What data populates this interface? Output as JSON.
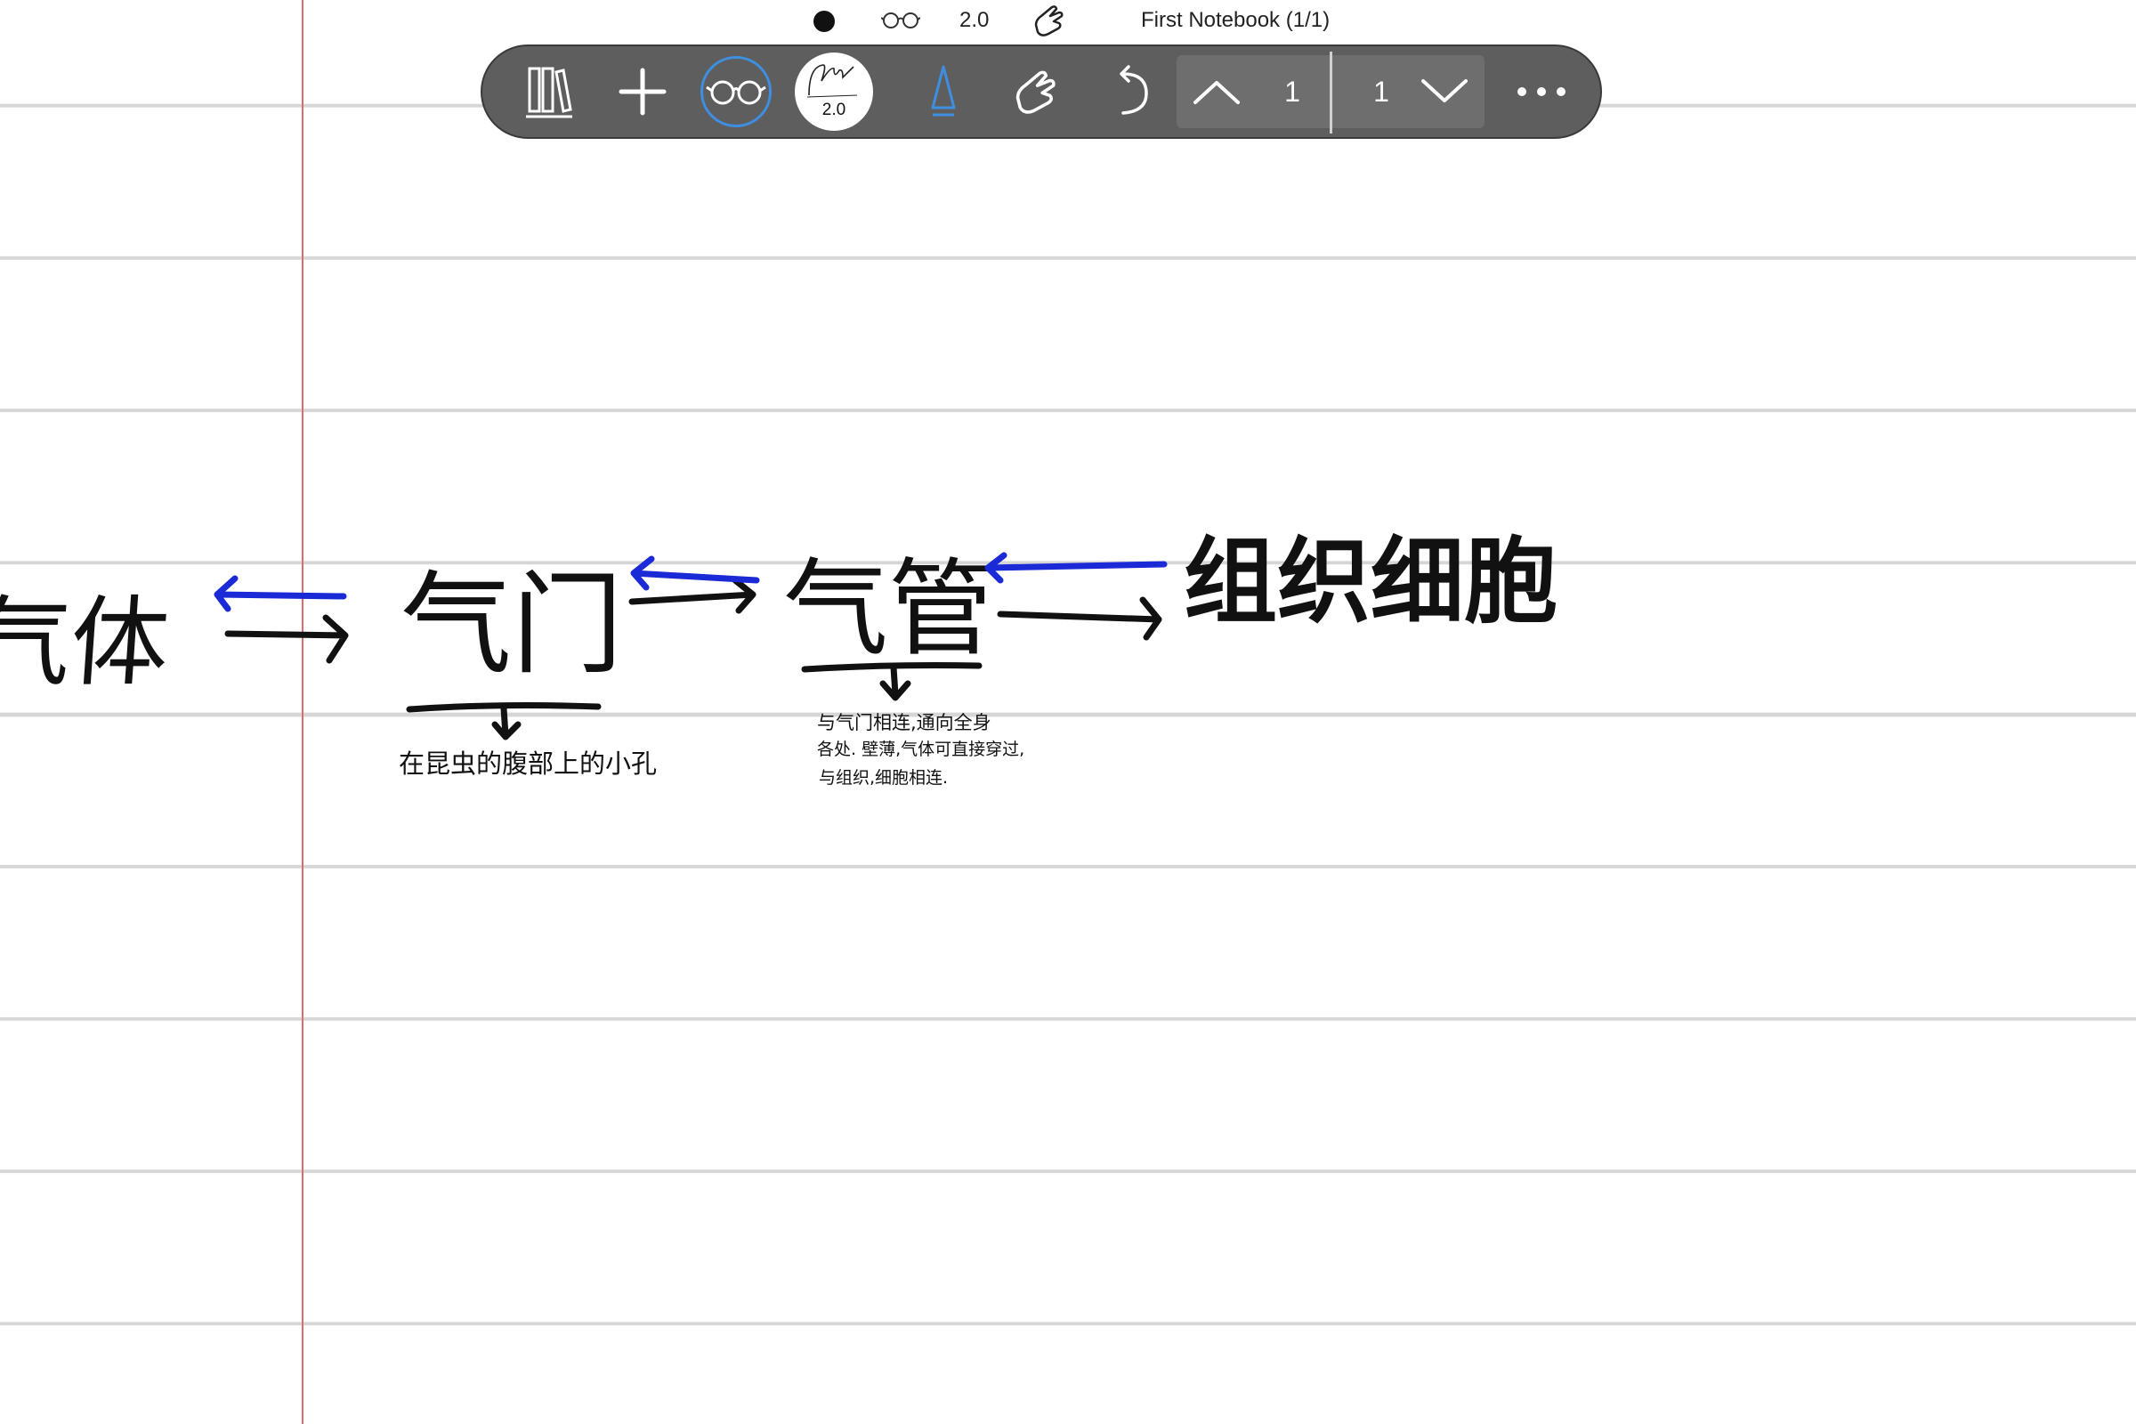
{
  "status": {
    "pen_width": "2.0",
    "notebook_title": "First Notebook (1/1)"
  },
  "toolbar": {
    "icons": {
      "library": "library-books-icon",
      "add": "plus-icon",
      "view": "glasses-icon",
      "pen": "pen-scribble-icon",
      "marker": "highlighter-icon",
      "hand": "hand-pointer-icon",
      "undo": "undo-icon",
      "page_up": "chevron-up-icon",
      "page_down": "chevron-down-icon",
      "more": "more-horizontal-icon"
    },
    "pen_size": "2.0",
    "page_current": "1",
    "page_total": "1"
  },
  "colors": {
    "toolbar_bg": "#5e5e5e",
    "accent_blue": "#3f8ee0",
    "ink_black": "#111111",
    "ink_blue": "#1a2ad6",
    "margin_red": "#e26a6a",
    "rule_gray": "#d6d6d6"
  },
  "handwriting": {
    "word_gas": "气体",
    "word_spiracle": "气门",
    "word_trachea": "气管",
    "word_tissue_cells": "组织细胞",
    "note_spiracle": "在昆虫的腹部上的小孔",
    "note_trachea_line1": "与气门相连,通向全身",
    "note_trachea_line2": "各处. 壁薄,气体可直接穿过,",
    "note_trachea_line3": "与组织,细胞相连."
  }
}
